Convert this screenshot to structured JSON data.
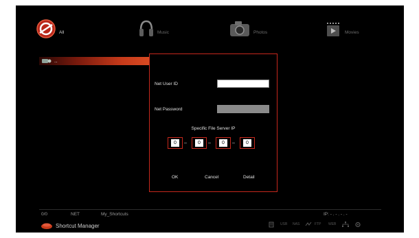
{
  "categories": [
    {
      "label": "All",
      "icon": "all-media-icon",
      "active": true
    },
    {
      "label": "Music",
      "icon": "headphones-icon",
      "active": false
    },
    {
      "label": "Photos",
      "icon": "camera-icon",
      "active": false
    },
    {
      "label": "Movies",
      "icon": "film-icon",
      "active": false
    }
  ],
  "file_row": {
    "label": "..",
    "icon": "network-folder-icon"
  },
  "dialog": {
    "user_id_label": "Net User ID",
    "user_id_value": "",
    "password_label": "Net Password",
    "password_value": "",
    "server_ip_label": "Specific File Server IP",
    "ip_octets": [
      "0",
      "0",
      "0",
      "0"
    ],
    "ok_label": "OK",
    "cancel_label": "Cancel",
    "detail_label": "Detail"
  },
  "status": {
    "count": "0/0",
    "source": "NET",
    "path": "My_Shortcuts",
    "ip": "IP: - . - . - . -",
    "manager_label": "Shortcut Manager",
    "indicators": [
      "USB",
      "NAS",
      "FTP",
      "WEB"
    ]
  },
  "colors": {
    "accent": "#c8281c",
    "background": "#000000"
  }
}
